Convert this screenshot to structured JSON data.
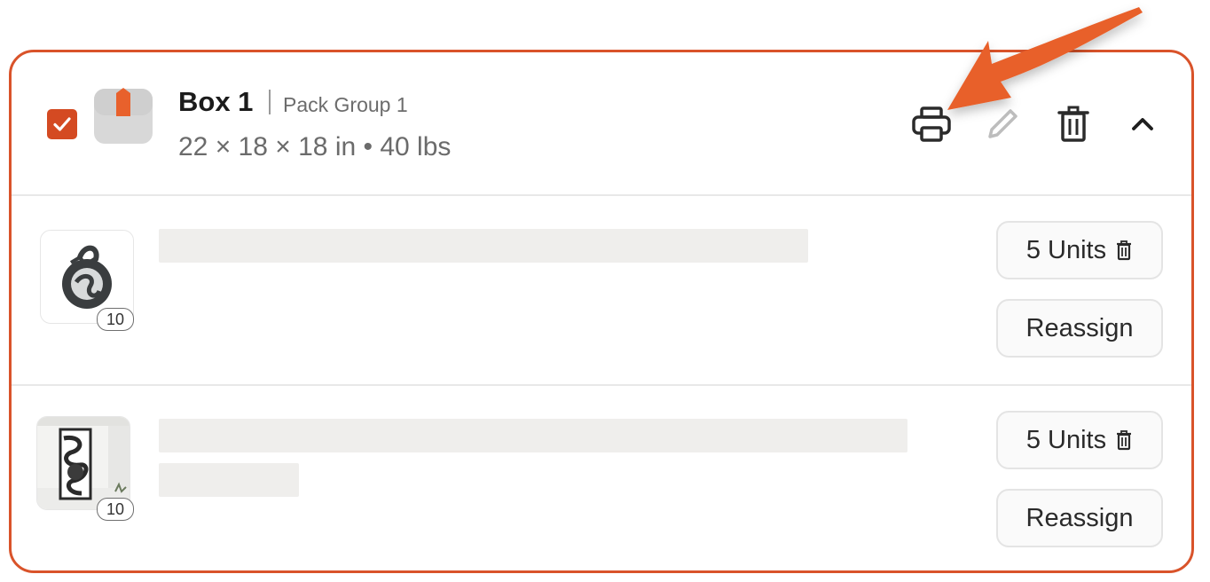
{
  "box": {
    "title": "Box 1",
    "group": "Pack Group 1",
    "dimensions": "22 × 18 × 18 in • 40 lbs",
    "checked": true,
    "accent_color": "#d44a22"
  },
  "header_actions": [
    {
      "name": "print",
      "icon": "printer-icon"
    },
    {
      "name": "edit",
      "icon": "pencil-icon"
    },
    {
      "name": "delete",
      "icon": "trash-icon"
    },
    {
      "name": "collapse",
      "icon": "chevron-up-icon"
    }
  ],
  "items": [
    {
      "qty_badge": "10",
      "units_label": "5 Units",
      "reassign_label": "Reassign",
      "image": "dragon-yin-yang-metal-art"
    },
    {
      "qty_badge": "10",
      "units_label": "5 Units",
      "reassign_label": "Reassign",
      "image": "dragon-panel-door-decor"
    }
  ],
  "annotation": {
    "type": "arrow",
    "color": "#e8612c",
    "points_to": "print-button"
  }
}
